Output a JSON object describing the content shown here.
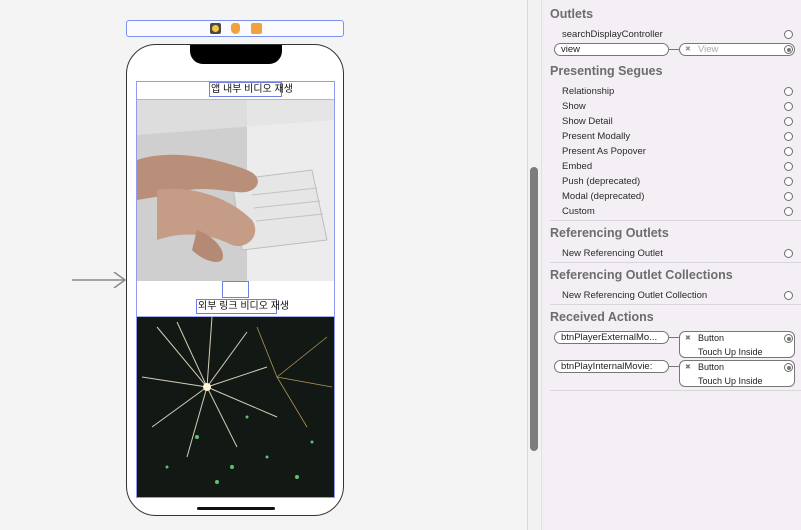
{
  "storyboard": {
    "scene_dock": {
      "icons": [
        "view-controller-icon",
        "first-responder-icon",
        "exit-icon"
      ]
    },
    "buttons": {
      "internal_label": "앱 내부 비디오 재생",
      "external_label": "외부 링크 비디오 재생"
    },
    "images": [
      "keyboard-photo",
      "fireworks-photo"
    ]
  },
  "inspector": {
    "outlets": {
      "title": "Outlets",
      "items": [
        "searchDisplayController",
        "view"
      ],
      "view_target": "View"
    },
    "presenting_segues": {
      "title": "Presenting Segues",
      "items": [
        "Relationship",
        "Show",
        "Show Detail",
        "Present Modally",
        "Present As Popover",
        "Embed",
        "Push (deprecated)",
        "Modal (deprecated)",
        "Custom"
      ]
    },
    "referencing_outlets": {
      "title": "Referencing Outlets",
      "items": [
        "New Referencing Outlet"
      ]
    },
    "referencing_outlet_collections": {
      "title": "Referencing Outlet Collections",
      "items": [
        "New Referencing Outlet Collection"
      ]
    },
    "received_actions": {
      "title": "Received Actions",
      "items": [
        {
          "action": "btnPlayerExternalMo...",
          "target": "Button",
          "event": "Touch Up Inside"
        },
        {
          "action": "btnPlayInternalMovie:",
          "target": "Button",
          "event": "Touch Up Inside"
        }
      ]
    }
  },
  "colors": {
    "selection_border": "#7d91f0",
    "dock_accent": "#f0a33a"
  }
}
